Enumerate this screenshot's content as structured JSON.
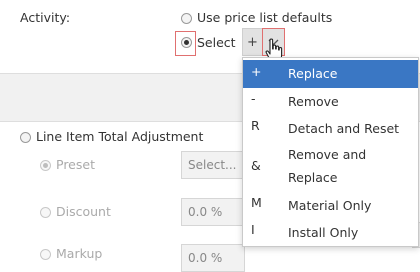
{
  "activity": {
    "label": "Activity:",
    "option_defaults": "Use price list defaults",
    "option_select": "Select"
  },
  "buttons": {
    "add_symbol": "+",
    "dropdown_symbol": "⌵"
  },
  "menu": {
    "items": [
      {
        "symbol": "+",
        "label": "Replace",
        "active": true
      },
      {
        "symbol": "-",
        "label": "Remove"
      },
      {
        "symbol": "R",
        "label": "Detach and Reset"
      },
      {
        "symbol": "&",
        "label_line1": "Remove and",
        "label_line2": "Replace"
      },
      {
        "symbol": "M",
        "label": "Material Only"
      },
      {
        "symbol": "I",
        "label": "Install Only"
      }
    ]
  },
  "adjustment": {
    "label": "Line Item Total Adjustment",
    "preset_label": "Preset",
    "preset_placeholder": "Select...",
    "discount_label": "Discount",
    "discount_value": "0.0 %",
    "markup_label": "Markup",
    "markup_value": "0.0 %"
  },
  "colors": {
    "menu_highlight": "#3a77c4",
    "focus_outline": "#e07070"
  }
}
